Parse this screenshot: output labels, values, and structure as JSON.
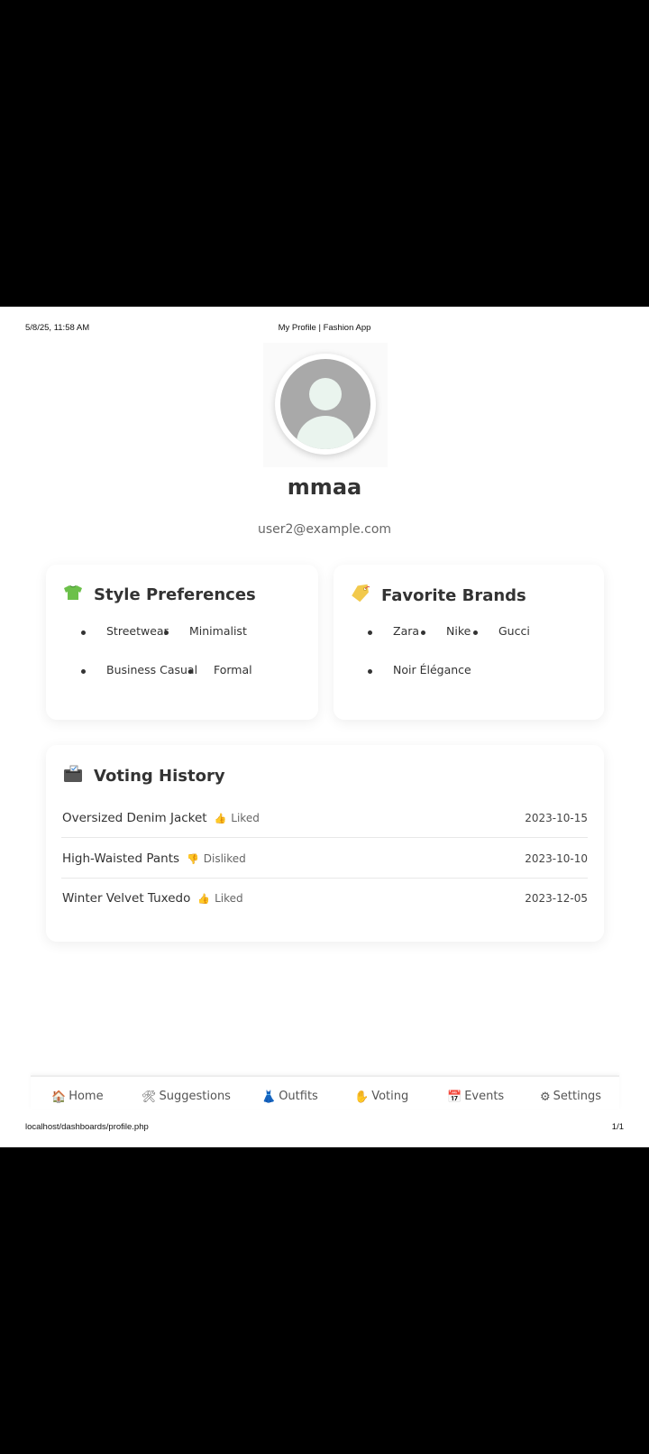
{
  "print": {
    "timestamp": "5/8/25, 11:58 AM",
    "document_title": "My Profile | Fashion App",
    "url": "localhost/dashboards/profile.php",
    "page_number": "1/1"
  },
  "profile": {
    "avatar_icon": "user-avatar-icon",
    "username": "mmaa",
    "email": "user2@example.com"
  },
  "style_preferences": {
    "title": "Style Preferences",
    "icon": "tshirt-icon",
    "items": [
      "Streetwear",
      "Minimalist",
      "Business Casual",
      "Formal"
    ]
  },
  "favorite_brands": {
    "title": "Favorite Brands",
    "icon": "tag-icon",
    "items": [
      "Zara",
      "Nike",
      "Gucci",
      "Noir Élégance"
    ]
  },
  "voting_history": {
    "title": "Voting History",
    "icon": "ballot-box-icon",
    "entries": [
      {
        "item": "Oversized Denim Jacket",
        "status": "Liked",
        "status_icon": "thumbs-up-icon",
        "date": "2023-10-15"
      },
      {
        "item": "High-Waisted Pants",
        "status": "Disliked",
        "status_icon": "thumbs-down-icon",
        "date": "2023-10-10"
      },
      {
        "item": "Winter Velvet Tuxedo",
        "status": "Liked",
        "status_icon": "thumbs-up-icon",
        "date": "2023-12-05"
      }
    ]
  },
  "nav": {
    "items": [
      {
        "label": "Home",
        "icon": "house-icon"
      },
      {
        "label": "Suggestions",
        "icon": "tools-icon"
      },
      {
        "label": "Outfits",
        "icon": "dress-icon"
      },
      {
        "label": "Voting",
        "icon": "hand-icon"
      },
      {
        "label": "Events",
        "icon": "calendar-icon"
      },
      {
        "label": "Settings",
        "icon": "gear-icon"
      }
    ]
  },
  "colors": {
    "avatar_gray": "#a9a9a9",
    "avatar_fill": "#eaf4ee",
    "tshirt_green": "#6cc04a",
    "tag_yellow": "#f2c94c",
    "page_bg": "#ffffff",
    "frame_bg": "#000000"
  }
}
